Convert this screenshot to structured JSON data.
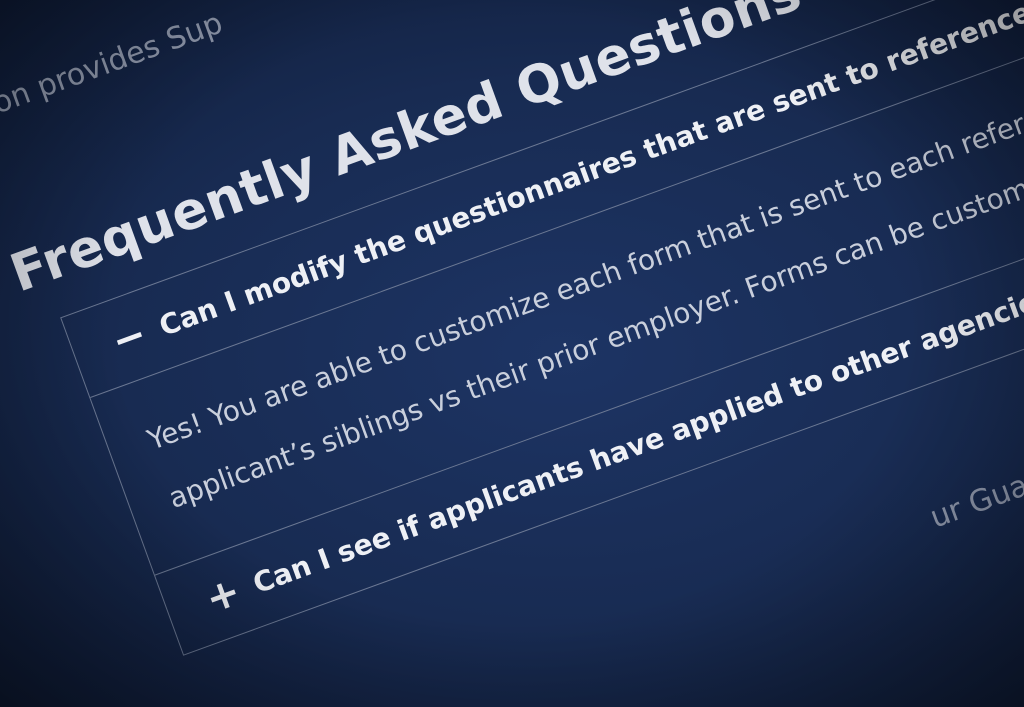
{
  "intro": {
    "text": "section provides Sup"
  },
  "faq": {
    "title": "Frequently Asked Questions",
    "items": [
      {
        "icon": "−",
        "question": "Can I modify the questionnaires that are sent to references?",
        "expanded": true,
        "answer_lines": [
          "Yes! You are able to customize each form that is sent to each reference typ",
          "applicant’s siblings vs their prior employer. Forms can be customized by a"
        ]
      },
      {
        "icon": "+",
        "question": "Can I see if applicants have applied to other agencies?",
        "expanded": false
      }
    ]
  },
  "footer": {
    "text": "ur Guardian"
  },
  "colors": {
    "background": "#1a2d55",
    "text": "#e6e8ee",
    "border": "#6b7893"
  }
}
